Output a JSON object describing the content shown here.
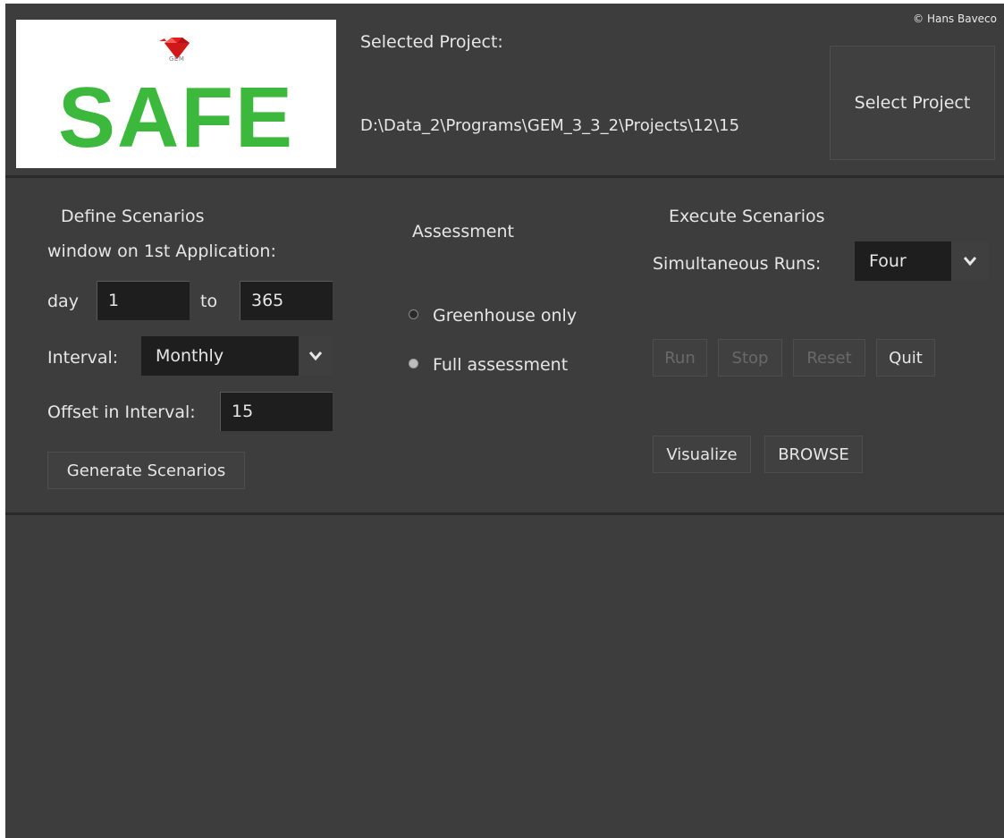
{
  "header": {
    "logo_text": "SAFE",
    "logo_sub": "GEM",
    "copyright": "© Hans Baveco",
    "selected_project_label": "Selected Project:",
    "project_path": "D:\\Data_2\\Programs\\GEM_3_3_2\\Projects\\12\\15",
    "select_project_button": "Select Project"
  },
  "define": {
    "title": "Define Scenarios",
    "window_label": "window on 1st Application:",
    "day_label": "day",
    "day_from": "1",
    "to_label": "to",
    "day_to": "365",
    "interval_label": "Interval:",
    "interval_value": "Monthly",
    "offset_label": "Offset in Interval:",
    "offset_value": "15",
    "generate_button": "Generate Scenarios"
  },
  "assessment": {
    "title": "Assessment",
    "options": [
      "Greenhouse only",
      "Full assessment"
    ],
    "selected": "Full assessment"
  },
  "execute": {
    "title": "Execute Scenarios",
    "runs_label": "Simultaneous Runs:",
    "runs_value": "Four",
    "run_button": "Run",
    "stop_button": "Stop",
    "reset_button": "Reset",
    "quit_button": "Quit",
    "visualize_button": "Visualize",
    "browse_button": "BROWSE"
  },
  "colors": {
    "logo_green": "#3cb83c",
    "gem_red": "#e02020",
    "background": "#3d3d3d",
    "input_bg": "#1e1e1e"
  }
}
